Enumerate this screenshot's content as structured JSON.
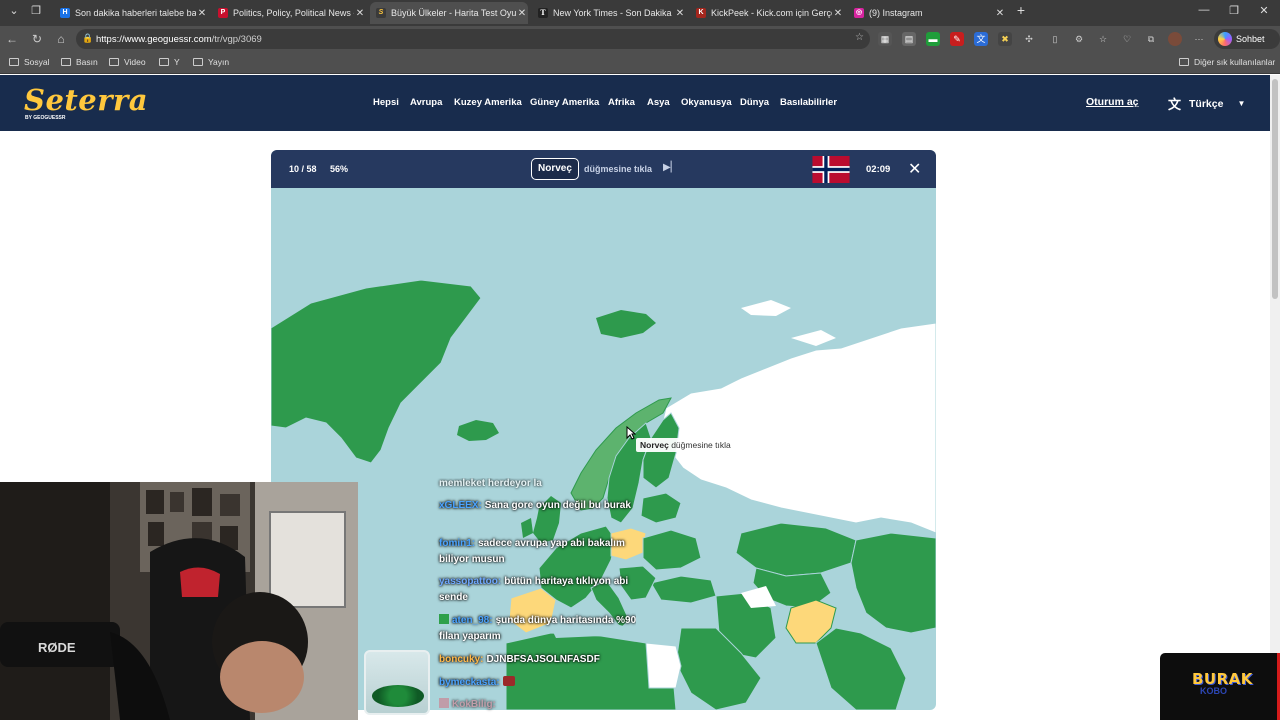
{
  "browser": {
    "tabs": [
      {
        "title": "Son dakika haberleri talebe bağlı ü",
        "favicon_color": "#1a73e8",
        "favicon": "H"
      },
      {
        "title": "Politics, Policy, Political News - PO",
        "favicon_color": "#c8102e",
        "favicon": "P"
      },
      {
        "title": "Büyük Ülkeler - Harita Test Oyunla",
        "favicon_color": "#ffc83d",
        "favicon": "S"
      },
      {
        "title": "New York Times - Son Dakika Hab",
        "favicon_color": "#222222",
        "favicon": "T"
      },
      {
        "title": "KickPeek - Kick.com için Gerçek Za",
        "favicon_color": "#a3261d",
        "favicon": "K"
      },
      {
        "title": "(9) Instagram",
        "favicon_color": "#d6249f",
        "favicon": "◎"
      }
    ],
    "url_host": "https://www.geoguessr.com",
    "url_path": "/tr/vgp/3069",
    "chat_button": "Sohbet et",
    "bookmarks": [
      "Sosyal",
      "Basın",
      "Video",
      "Y",
      "Yayın"
    ],
    "other_bookmarks": "Diğer sık kullanılanlar"
  },
  "site": {
    "logo": "Seterra",
    "logo_sub": "BY GEOGUESSR",
    "nav": [
      "Hepsi",
      "Avrupa",
      "Kuzey Amerika",
      "Güney Amerika",
      "Afrika",
      "Asya",
      "Okyanusya",
      "Dünya",
      "Basılabilirler"
    ],
    "login": "Oturum aç",
    "language": "Türkçe"
  },
  "game": {
    "progress": "10 / 58",
    "percent": "56%",
    "target_country": "Norveç",
    "instruction": "düğmesine tıkla",
    "timer": "02:09",
    "tooltip_country": "Norveç",
    "tooltip_text": "düğmesine tıkla",
    "colors": {
      "sea": "#aad4da",
      "found": "#2e9a4d",
      "highlight": "#5db36e",
      "wrong": "#fdd87a",
      "unplayed": "#ffffff"
    }
  },
  "stream": {
    "chat": [
      {
        "user": "",
        "text": "memleket herdeyor la",
        "color": "#ffffff"
      },
      {
        "user": "xGLEEX:",
        "text": "Sana gore oyun değil bu burak",
        "color": "#4aa3ff"
      },
      {
        "user": "fomin1:",
        "text": "sadece avrupa yap abi bakalım biliyor musun",
        "color": "#4aa3ff"
      },
      {
        "user": "yassopattoo:",
        "text": "bütün haritaya tıklıyon abi sende",
        "color": "#6fa8ff"
      },
      {
        "user": "aten_98:",
        "text": "şunda dünya haritasında %90 filan yaparım",
        "color": "#4aa3ff"
      },
      {
        "user": "boncuky:",
        "text": "DJNBFSAJSOLNFASDF",
        "color": "#ffb84a"
      },
      {
        "user": "bymeckasta:",
        "text": "",
        "color": "#4aa3ff"
      },
      {
        "user": "KokBilig:",
        "text": "",
        "color": "#d07a8a"
      }
    ],
    "brand": "BURAK",
    "brand_sub": "KOBO"
  }
}
